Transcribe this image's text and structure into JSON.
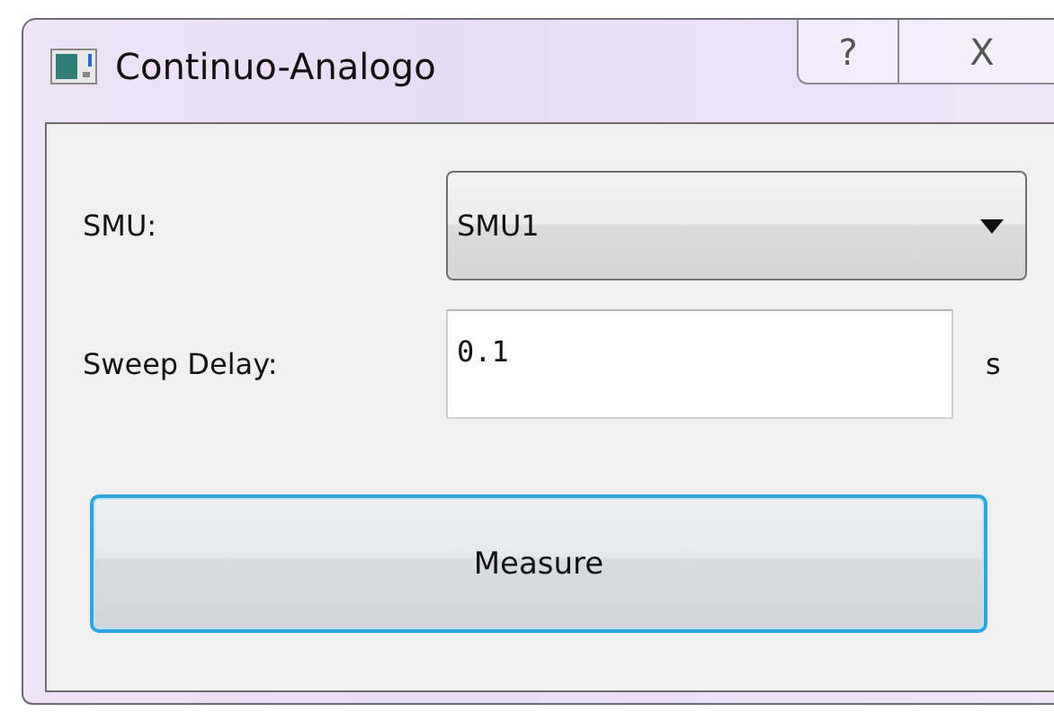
{
  "window": {
    "title": "Continuo-Analogo",
    "title_buttons": [
      {
        "kind": "help",
        "label": "?"
      },
      {
        "kind": "close",
        "label": "X"
      }
    ]
  },
  "smu": {
    "label": "SMU:",
    "value": "SMU1"
  },
  "sweep_delay": {
    "label": "Sweep Delay:",
    "value": "0.1",
    "unit": "s"
  },
  "measure_button": {
    "label": "Measure",
    "focused": true
  }
}
